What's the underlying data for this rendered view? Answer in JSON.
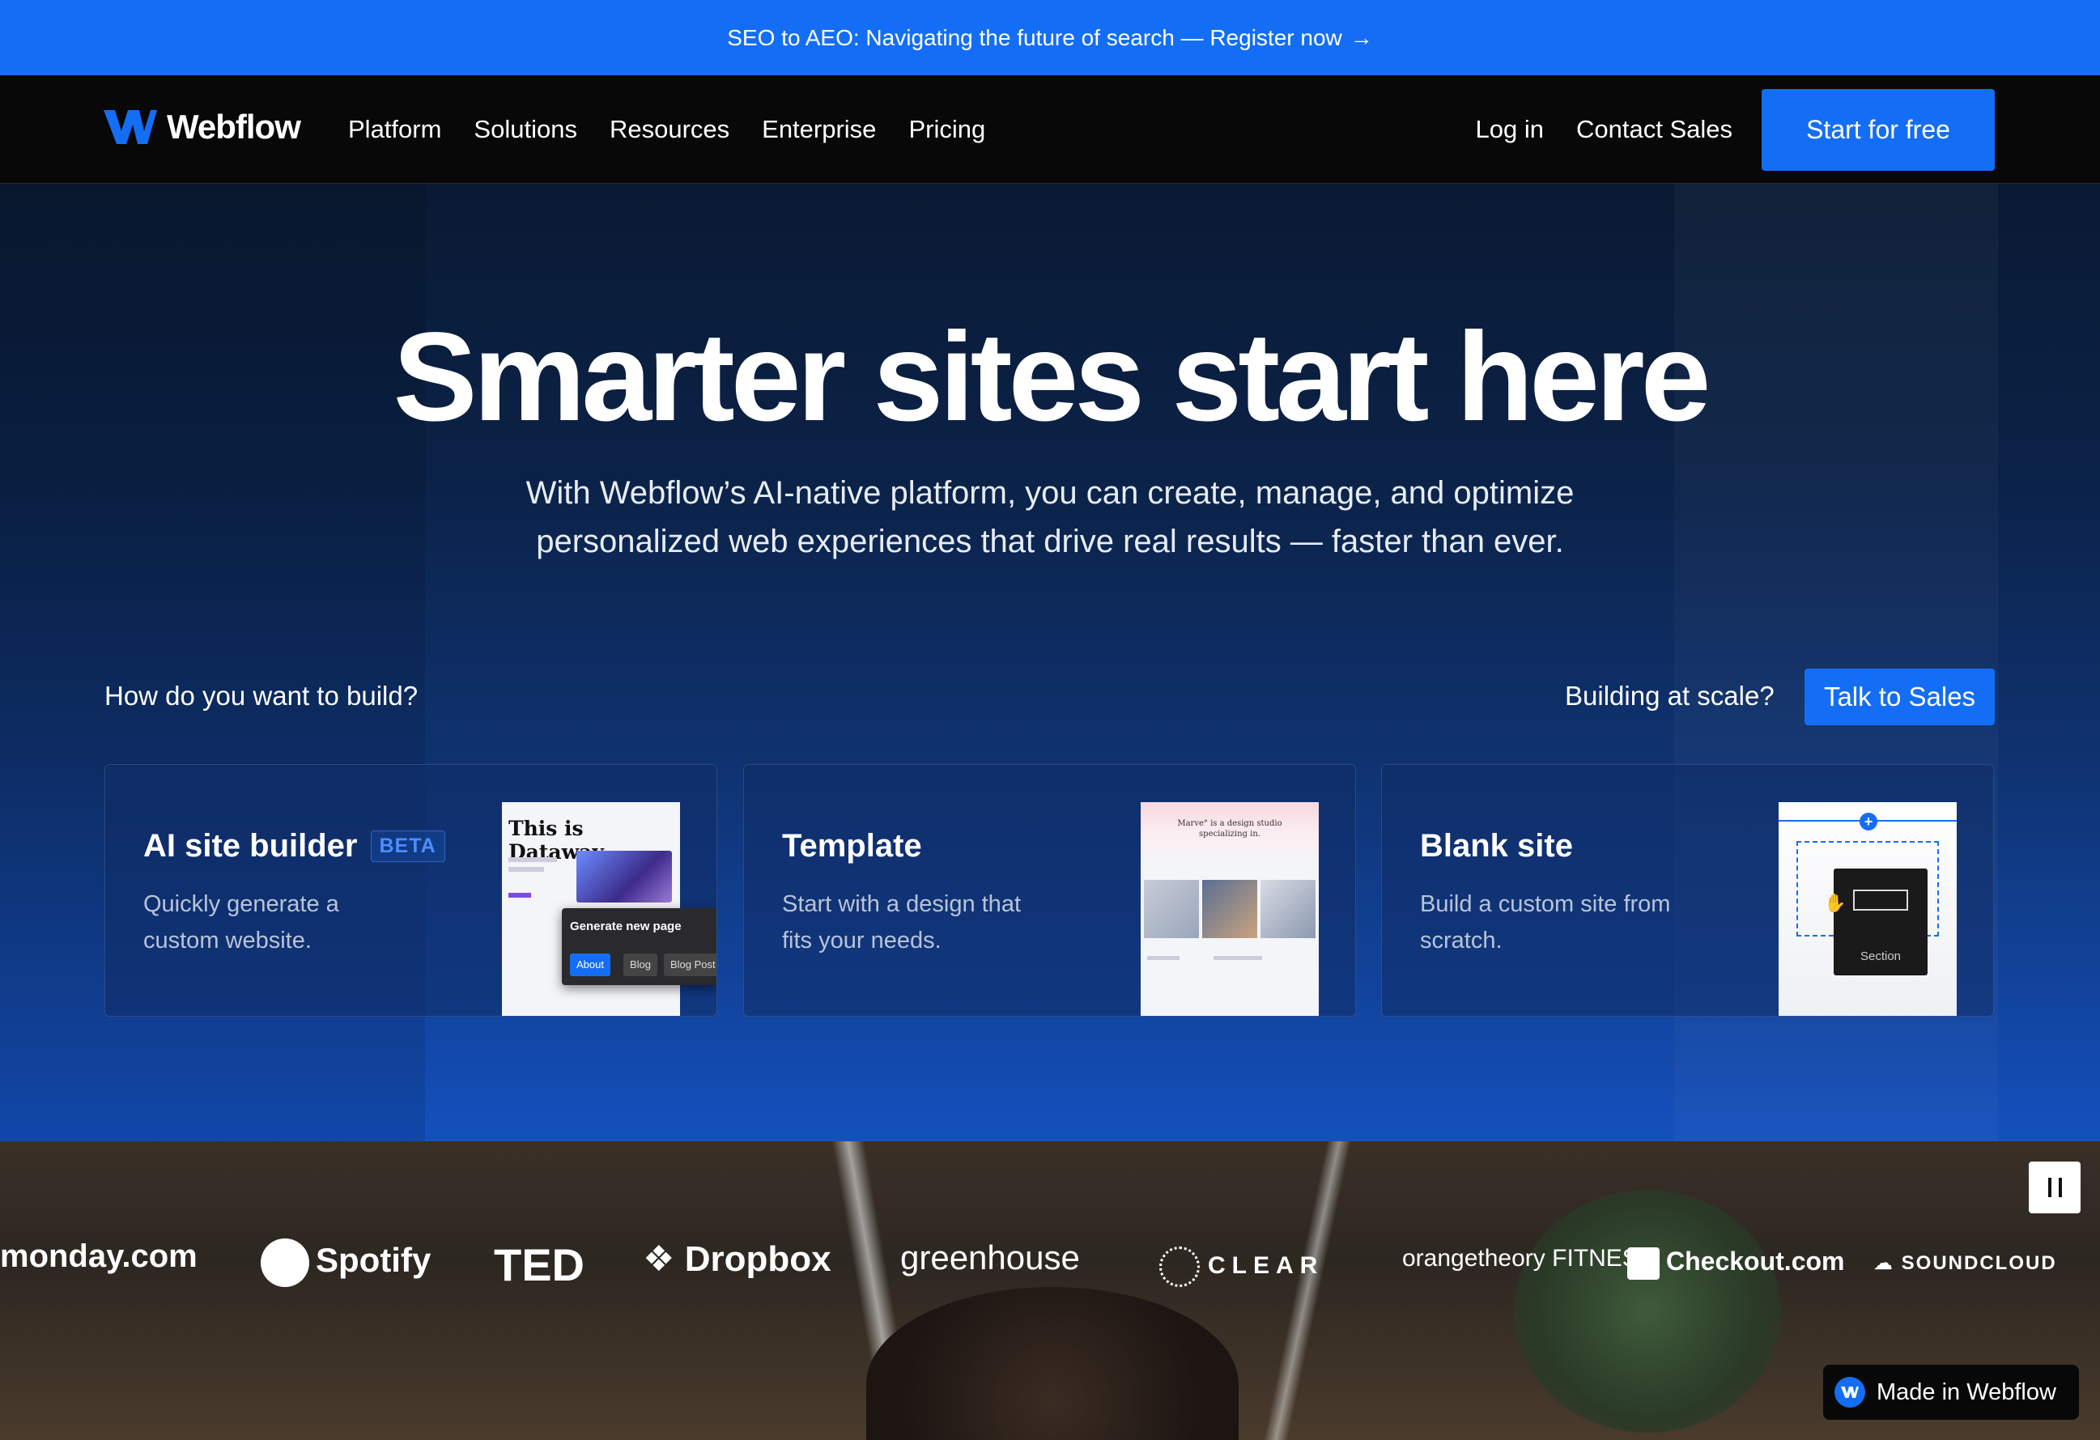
{
  "banner": {
    "text": "SEO to AEO: Navigating the future of search — Register now",
    "arrow": "→"
  },
  "nav": {
    "brand": "Webflow",
    "links": [
      "Platform",
      "Solutions",
      "Resources",
      "Enterprise",
      "Pricing"
    ],
    "login": "Log in",
    "contact": "Contact Sales",
    "cta": "Start for free"
  },
  "hero": {
    "title": "Smarter sites start here",
    "subtitle": "With Webflow’s AI-native platform, you can create, manage, and optimize personalized web experiences that drive real results — faster than ever.",
    "build_question": "How do you want to build?",
    "scale_question": "Building at scale?",
    "talk_cta": "Talk to Sales"
  },
  "cards": [
    {
      "title": "AI site builder",
      "badge": "BETA",
      "desc": "Quickly generate a custom website.",
      "thumb": {
        "heading": "This is Dataway",
        "popup_title": "Generate new page",
        "chips": [
          "About",
          "Blog",
          "Blog Post"
        ]
      }
    },
    {
      "title": "Template",
      "desc": "Start with a design that fits your needs.",
      "thumb": {
        "heading": "Marve° is a design studio specializing in."
      }
    },
    {
      "title": "Blank site",
      "desc": "Build a custom site from scratch.",
      "thumb": {
        "label": "Section"
      }
    }
  ],
  "logos": [
    "monday.com",
    "Spotify",
    "TED",
    "Dropbox",
    "greenhouse",
    "CLEAR",
    "orangetheory FITNESS",
    "Checkout.com",
    "SOUNDCLOUD"
  ],
  "badge": {
    "text": "Made in Webflow"
  },
  "colors": {
    "accent": "#146ef5",
    "nav_bg": "#080808"
  }
}
